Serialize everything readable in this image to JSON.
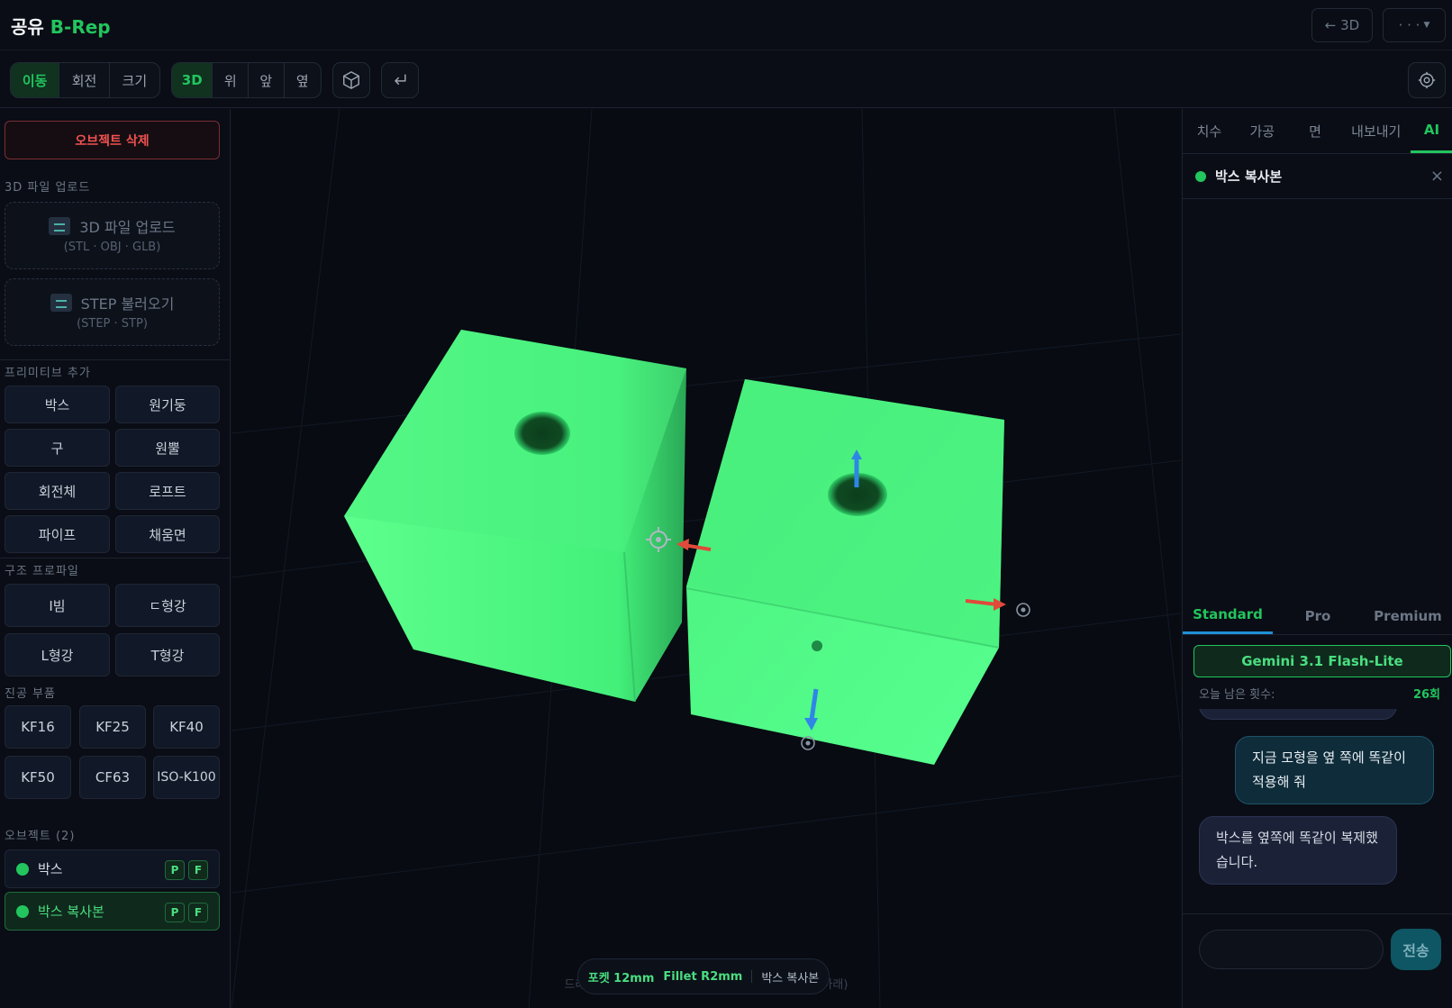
{
  "header": {
    "logo_main": "공유",
    "logo_accent": "B-Rep",
    "back_label": "← 3D",
    "menu_label": "· · ·"
  },
  "toolbar": {
    "transform": [
      "이동",
      "회전",
      "크기"
    ],
    "views": [
      "3D",
      "위",
      "앞",
      "옆"
    ]
  },
  "left": {
    "delete_label": "오브젝트 삭제",
    "upload_section": "3D 파일 업로드",
    "upload": {
      "title": "3D 파일 업로드",
      "formats": "(STL · OBJ · GLB)"
    },
    "step": {
      "title": "STEP 불러오기",
      "formats": "(STEP · STP)"
    },
    "primitive_section": "프리미티브 추가",
    "primitives": [
      "박스",
      "원기둥",
      "구",
      "원뿔",
      "회전체",
      "로프트",
      "파이프",
      "채움면"
    ],
    "profile_section": "구조 프로파일",
    "profiles": [
      "I빔",
      "ㄷ형강",
      "L형강",
      "T형강"
    ],
    "vacuum_section": "진공 부품",
    "vacuum": [
      "KF16",
      "KF25",
      "KF40",
      "KF50",
      "CF63",
      "ISO-K100"
    ],
    "objects_section": "오브젝트 (2)",
    "objects": [
      {
        "name": "박스",
        "tag_p": "P",
        "tag_f": "F"
      },
      {
        "name": "박스 복사본",
        "tag_p": "P",
        "tag_f": "F"
      }
    ]
  },
  "viewport": {
    "status_pocket": "포켓 12mm",
    "status_fillet": "Fillet R2mm",
    "status_object": "박스 복사본",
    "drag_left": "드래그",
    "drag_right": "아래)",
    "accent_color": "#22c55e"
  },
  "right": {
    "tabs": [
      "치수",
      "가공",
      "면",
      "내보내기",
      "AI"
    ],
    "selected_object": "박스 복사본",
    "close_icon": "×",
    "tiers": [
      "Standard",
      "Pro",
      "Premium"
    ],
    "model_name": "Gemini 3.1 Flash-Lite",
    "remaining_label": "오늘 남은 횟수:",
    "remaining_count": "26회",
    "messages": [
      {
        "role": "user",
        "text": "지금 모형을 옆 쪽에 똑같이 적용해 줘"
      },
      {
        "role": "bot",
        "text": "박스를 옆쪽에 똑같이 복제했습니다."
      }
    ],
    "send_label": "전송"
  }
}
